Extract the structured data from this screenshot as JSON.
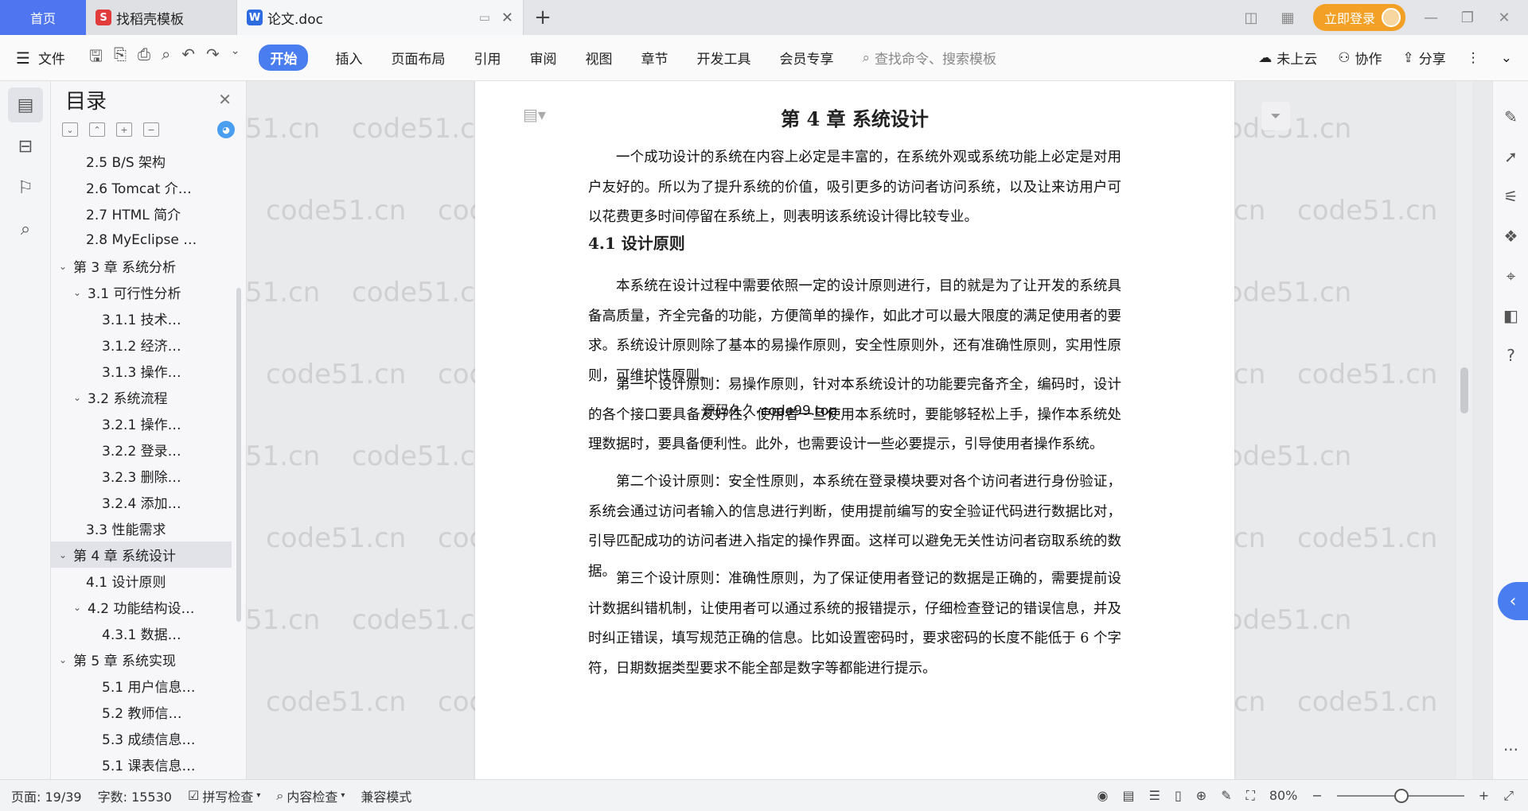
{
  "tabs": {
    "home": "首页",
    "template_tab": "找稻壳模板",
    "doc_tab": "论文.doc",
    "new_tab": "+"
  },
  "top_right": {
    "login": "立即登录"
  },
  "toolbar": {
    "file": "文件",
    "menus": [
      "开始",
      "插入",
      "页面布局",
      "引用",
      "审阅",
      "视图",
      "章节",
      "开发工具",
      "会员专享"
    ],
    "search_placeholder": "查找命令、搜索模板",
    "cloud": "未上云",
    "collab": "协作",
    "share": "分享"
  },
  "toc": {
    "title": "目录",
    "items": [
      {
        "label": "2.5 B/S 架构",
        "level": 2,
        "caret": ""
      },
      {
        "label": "2.6 Tomcat 介…",
        "level": 2,
        "caret": ""
      },
      {
        "label": "2.7 HTML 简介",
        "level": 2,
        "caret": ""
      },
      {
        "label": "2.8 MyEclipse …",
        "level": 2,
        "caret": ""
      },
      {
        "label": "第 3 章  系统分析",
        "level": 1,
        "caret": "v"
      },
      {
        "label": "3.1  可行性分析",
        "level": 2,
        "caret": "v"
      },
      {
        "label": "3.1.1  技术…",
        "level": 3,
        "caret": ""
      },
      {
        "label": "3.1.2  经济…",
        "level": 3,
        "caret": ""
      },
      {
        "label": "3.1.3  操作…",
        "level": 3,
        "caret": ""
      },
      {
        "label": "3.2  系统流程",
        "level": 2,
        "caret": "v"
      },
      {
        "label": "3.2.1  操作…",
        "level": 3,
        "caret": ""
      },
      {
        "label": "3.2.2  登录…",
        "level": 3,
        "caret": ""
      },
      {
        "label": "3.2.3  删除…",
        "level": 3,
        "caret": ""
      },
      {
        "label": "3.2.4  添加…",
        "level": 3,
        "caret": ""
      },
      {
        "label": "3.3  性能需求",
        "level": 2,
        "caret": ""
      },
      {
        "label": "第 4 章  系统设计",
        "level": 1,
        "caret": "v",
        "selected": true
      },
      {
        "label": "4.1  设计原则",
        "level": 2,
        "caret": ""
      },
      {
        "label": "4.2  功能结构设…",
        "level": 2,
        "caret": "v"
      },
      {
        "label": "4.3.1  数据…",
        "level": 3,
        "caret": ""
      },
      {
        "label": "第 5 章  系统实现",
        "level": 1,
        "caret": "v"
      },
      {
        "label": "5.1 用户信息…",
        "level": 3,
        "caret": ""
      },
      {
        "label": "5.2  教师信…",
        "level": 3,
        "caret": ""
      },
      {
        "label": "5.3 成绩信息…",
        "level": 3,
        "caret": ""
      },
      {
        "label": "5.1 课表信息…",
        "level": 3,
        "caret": ""
      }
    ]
  },
  "document": {
    "chapter_title": "第 4 章  系统设计",
    "intro": "一个成功设计的系统在内容上必定是丰富的，在系统外观或系统功能上必定是对用户友好的。所以为了提升系统的价值，吸引更多的访问者访问系统，以及让来访用户可以花费更多时间停留在系统上，则表明该系统设计得比较专业。",
    "section_title": "4.1  设计原则",
    "para1": "本系统在设计过程中需要依照一定的设计原则进行，目的就是为了让开发的系统具备高质量，齐全完备的功能，方便简单的操作，如此才可以最大限度的满足使用者的要求。系统设计原则除了基本的易操作原则，安全性原则外，还有准确性原则，实用性原则，可维护性原则。",
    "overlay_text": "源码久久-code99.top",
    "para2": "第一个设计原则：易操作原则，针对本系统设计的功能要完备齐全，编码时，设计的各个接口要具备友好性，使用者一旦使用本系统时，要能够轻松上手，操作本系统处理数据时，要具备便利性。此外，也需要设计一些必要提示，引导使用者操作系统。",
    "para3": "第二个设计原则：安全性原则，本系统在登录模块要对各个访问者进行身份验证，系统会通过访问者输入的信息进行判断，使用提前编写的安全验证代码进行数据比对，引导匹配成功的访问者进入指定的操作界面。这样可以避免无关性访问者窃取系统的数据。",
    "para4": "第三个设计原则：准确性原则，为了保证使用者登记的数据是正确的，需要提前设计数据纠错机制，让使用者可以通过系统的报错提示，仔细检查登记的错误信息，并及时纠正错误，填写规范正确的信息。比如设置密码时，要求密码的长度不能低于 6 个字符，日期数据类型要求不能全部是数字等都能进行提示。"
  },
  "watermark": "code51.cn",
  "status": {
    "page": "页面: 19/39",
    "words": "字数: 15530",
    "spell": "拼写检查",
    "content": "内容检查",
    "compat": "兼容模式",
    "zoom": "80%"
  },
  "colors": {
    "accent": "#4a7ef0",
    "login": "#f2a126"
  }
}
